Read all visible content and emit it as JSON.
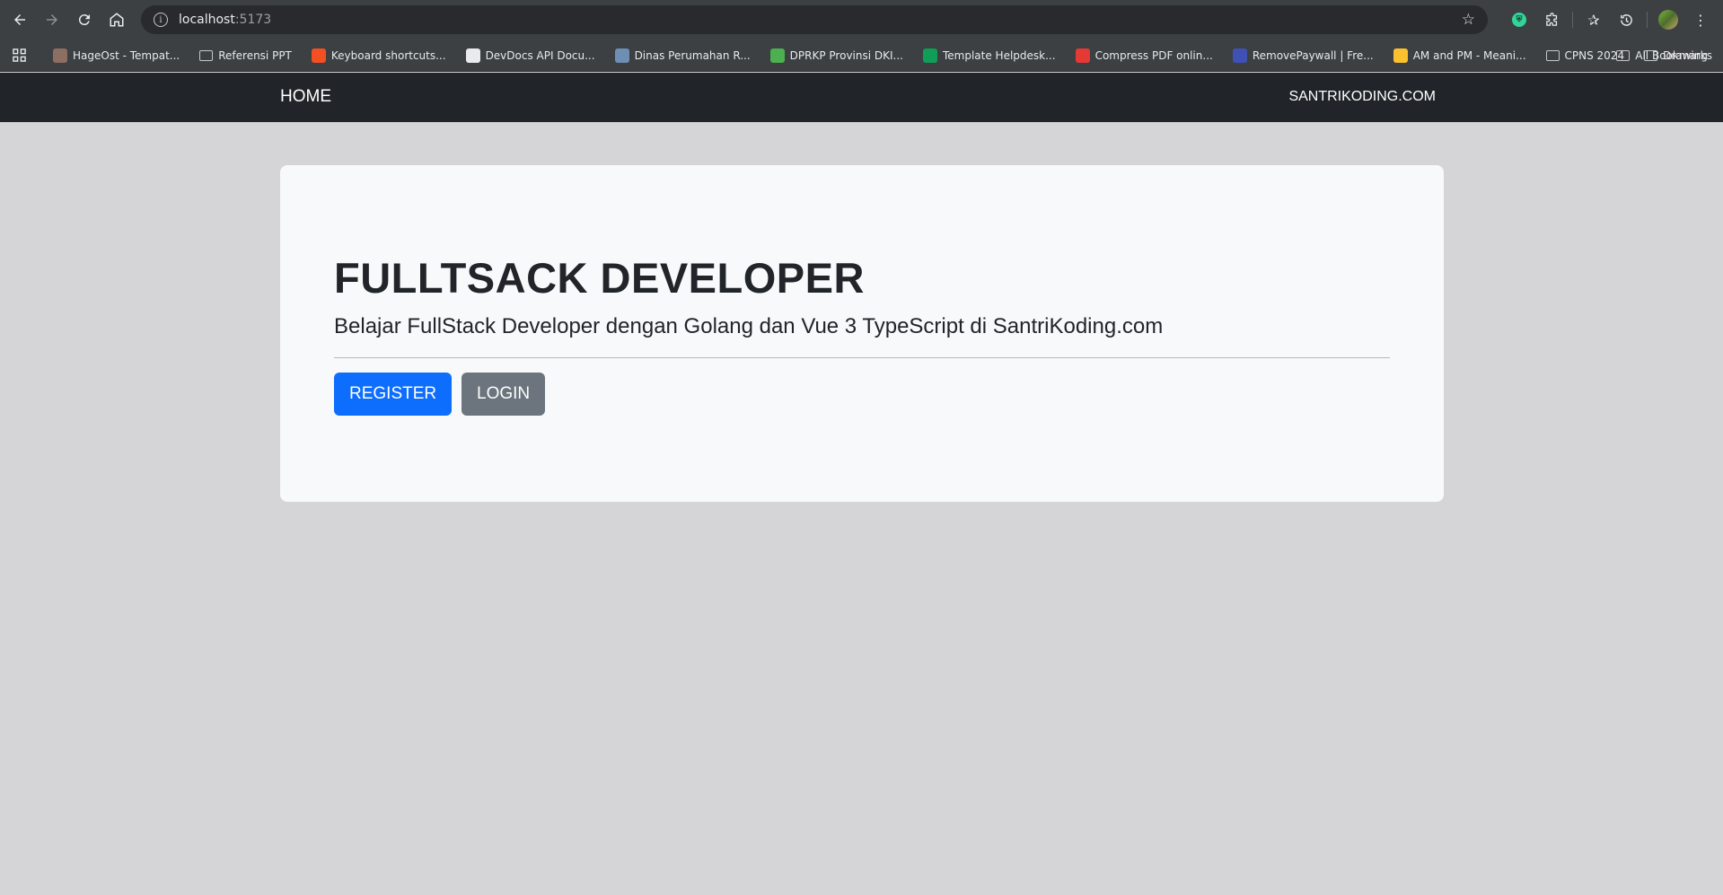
{
  "browser": {
    "url_host": "localhost",
    "url_port": ":5173"
  },
  "bookmarks": [
    {
      "label": "HageOst - Tempat...",
      "type": "site",
      "icon": "avatar-favicon",
      "color": "#8d6e63"
    },
    {
      "label": "Referensi PPT",
      "type": "folder"
    },
    {
      "label": "Keyboard shortcuts...",
      "type": "site",
      "icon": "microsoft-favicon",
      "color": "#f25022"
    },
    {
      "label": "DevDocs API Docu...",
      "type": "site",
      "icon": "devdocs-favicon",
      "color": "#e8eaed"
    },
    {
      "label": "Dinas Perumahan R...",
      "type": "site",
      "icon": "emblem-favicon",
      "color": "#6d8fb3"
    },
    {
      "label": "DPRKP Provinsi DKI...",
      "type": "site",
      "icon": "star-favicon",
      "color": "#4caf50"
    },
    {
      "label": "Template Helpdesk...",
      "type": "site",
      "icon": "sheets-favicon",
      "color": "#0f9d58"
    },
    {
      "label": "Compress PDF onlin...",
      "type": "site",
      "icon": "heart-favicon",
      "color": "#e53935"
    },
    {
      "label": "RemovePaywall | Fre...",
      "type": "site",
      "icon": "diamond-favicon",
      "color": "#3f51b5"
    },
    {
      "label": "AM and PM - Meani...",
      "type": "site",
      "icon": "clock-favicon",
      "color": "#fbc02d"
    },
    {
      "label": "CPNS 2024",
      "type": "folder"
    },
    {
      "label": "Drawing",
      "type": "folder"
    }
  ],
  "bookmarks_all": "All Bookmarks",
  "navbar": {
    "brand": "HOME",
    "site_link": "SANTRIKODING.COM"
  },
  "hero": {
    "title": "FULLTSACK DEVELOPER",
    "lead": "Belajar FullStack Developer dengan Golang dan Vue 3 TypeScript di SantriKoding.com",
    "register_label": "REGISTER",
    "login_label": "LOGIN"
  },
  "colors": {
    "page_bg": "#d5d4d7",
    "navbar_bg": "#212529",
    "card_bg": "#f8f9fa",
    "primary": "#0d6efd",
    "secondary": "#6c757d"
  }
}
